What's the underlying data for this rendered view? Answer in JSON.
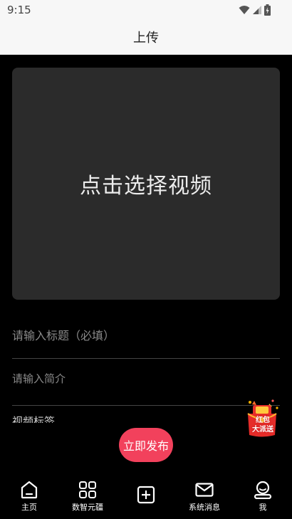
{
  "status_bar": {
    "time": "9:15"
  },
  "header": {
    "title": "上传"
  },
  "video_picker": {
    "label": "点击选择视频"
  },
  "form": {
    "title_placeholder": "请输入标题（必填）",
    "intro_placeholder": "请输入简介",
    "tags_label": "视频标签"
  },
  "publish_button": {
    "label": "立即发布"
  },
  "red_packet": {
    "line1": "红包",
    "line2": "大派送"
  },
  "bottom_nav": {
    "items": [
      {
        "label": "主页",
        "icon": "home-icon"
      },
      {
        "label": "数智元疆",
        "icon": "grid-icon"
      },
      {
        "label": "",
        "icon": "add-square-icon"
      },
      {
        "label": "系统消息",
        "icon": "mail-icon"
      },
      {
        "label": "我",
        "icon": "profile-icon"
      }
    ]
  },
  "colors": {
    "background": "#000000",
    "accent": "#f2415c",
    "picker_bg": "#2b2b2b",
    "header_bg": "#f7f7f7"
  }
}
